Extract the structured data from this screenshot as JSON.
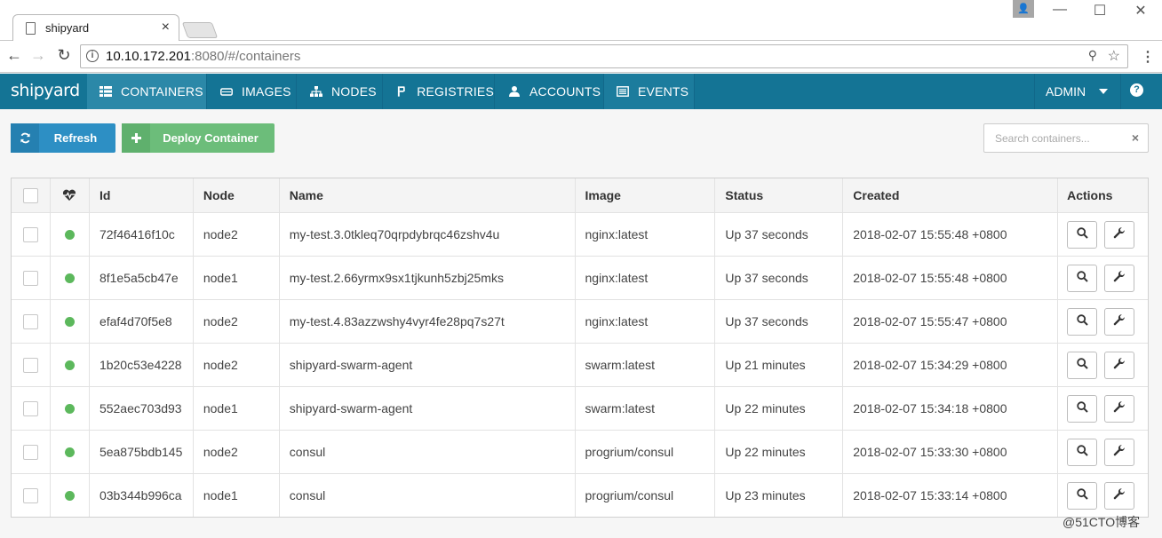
{
  "browser": {
    "tab_title": "shipyard",
    "tab_close": "×",
    "url_host": "10.10.172.201",
    "url_rest": ":8080/#/containers",
    "info_glyph": "i",
    "profile_glyph": "👤",
    "win_minimize": "—",
    "win_maximize": "☐",
    "win_close": "✕",
    "back_glyph": "←",
    "forward_glyph": "→",
    "reload_glyph": "↻",
    "key_glyph": "⚲",
    "star_glyph": "☆",
    "menu_glyph": "⋮"
  },
  "app": {
    "brand": "shipyard",
    "nav": [
      {
        "label": "CONTAINERS",
        "icon": "grid-icon"
      },
      {
        "label": "IMAGES",
        "icon": "hdd-icon"
      },
      {
        "label": "NODES",
        "icon": "sitemap-icon"
      },
      {
        "label": "REGISTRIES",
        "icon": "registry-icon"
      },
      {
        "label": "ACCOUNTS",
        "icon": "user-icon"
      },
      {
        "label": "EVENTS",
        "icon": "list-icon"
      }
    ],
    "user_menu": "ADMIN",
    "help_glyph": "?"
  },
  "toolbar": {
    "refresh_label": "Refresh",
    "deploy_label": "Deploy Container",
    "search_placeholder": "Search containers...",
    "search_clear": "×"
  },
  "table": {
    "headers": {
      "id": "Id",
      "node": "Node",
      "name": "Name",
      "image": "Image",
      "status": "Status",
      "created": "Created",
      "actions": "Actions"
    },
    "rows": [
      {
        "id": "72f46416f10c",
        "node": "node2",
        "name": "my-test.3.0tkleq70qrpdybrqc46zshv4u",
        "image": "nginx:latest",
        "status": "Up 37 seconds",
        "created": "2018-02-07 15:55:48 +0800"
      },
      {
        "id": "8f1e5a5cb47e",
        "node": "node1",
        "name": "my-test.2.66yrmx9sx1tjkunh5zbj25mks",
        "image": "nginx:latest",
        "status": "Up 37 seconds",
        "created": "2018-02-07 15:55:48 +0800"
      },
      {
        "id": "efaf4d70f5e8",
        "node": "node2",
        "name": "my-test.4.83azzwshy4vyr4fe28pq7s27t",
        "image": "nginx:latest",
        "status": "Up 37 seconds",
        "created": "2018-02-07 15:55:47 +0800"
      },
      {
        "id": "1b20c53e4228",
        "node": "node2",
        "name": "shipyard-swarm-agent",
        "image": "swarm:latest",
        "status": "Up 21 minutes",
        "created": "2018-02-07 15:34:29 +0800"
      },
      {
        "id": "552aec703d93",
        "node": "node1",
        "name": "shipyard-swarm-agent",
        "image": "swarm:latest",
        "status": "Up 22 minutes",
        "created": "2018-02-07 15:34:18 +0800"
      },
      {
        "id": "5ea875bdb145",
        "node": "node2",
        "name": "consul",
        "image": "progrium/consul",
        "status": "Up 22 minutes",
        "created": "2018-02-07 15:33:30 +0800"
      },
      {
        "id": "03b344b996ca",
        "node": "node1",
        "name": "consul",
        "image": "progrium/consul",
        "status": "Up 23 minutes",
        "created": "2018-02-07 15:33:14 +0800"
      }
    ]
  },
  "watermark": "@51CTO博客",
  "colors": {
    "navbar": "#147495",
    "nav_active": "#2b88a8",
    "refresh_button": "#2d8fc4",
    "deploy_button": "#6cbd7a",
    "health_ok": "#5cb85c"
  }
}
